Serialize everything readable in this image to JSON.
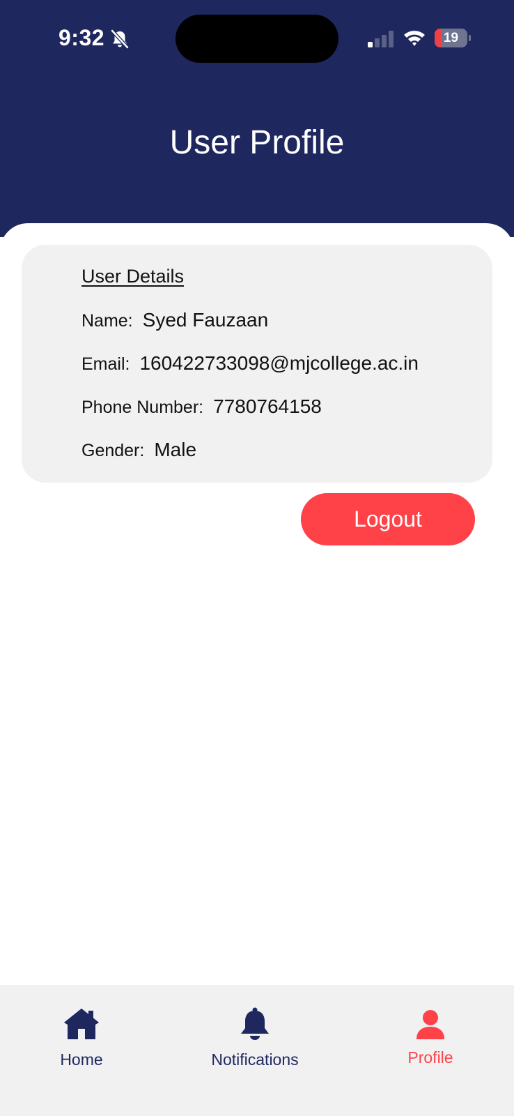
{
  "status_bar": {
    "time": "9:32",
    "battery_level": "19",
    "battery_fraction": 0.19,
    "icons": [
      "bell-slash-icon",
      "cellular-signal-icon",
      "wifi-icon",
      "battery-icon"
    ]
  },
  "header": {
    "title": "User Profile"
  },
  "user_details": {
    "heading": "User Details",
    "rows": [
      {
        "label": "Name:",
        "value": "Syed Fauzaan"
      },
      {
        "label": "Email:",
        "value": "160422733098@mjcollege.ac.in"
      },
      {
        "label": "Phone Number:",
        "value": "7780764158"
      },
      {
        "label": "Gender:",
        "value": "Male"
      }
    ]
  },
  "actions": {
    "logout_label": "Logout"
  },
  "tab_bar": {
    "tabs": [
      {
        "label": "Home",
        "icon": "home-icon",
        "active": false
      },
      {
        "label": "Notifications",
        "icon": "bell-icon",
        "active": false
      },
      {
        "label": "Profile",
        "icon": "person-icon",
        "active": true
      }
    ]
  },
  "colors": {
    "header_bg": "#1f285e",
    "accent_red": "#ff4148",
    "card_bg": "#f1f1f2",
    "tab_inactive": "#1f285e",
    "tab_active": "#ff4148"
  }
}
